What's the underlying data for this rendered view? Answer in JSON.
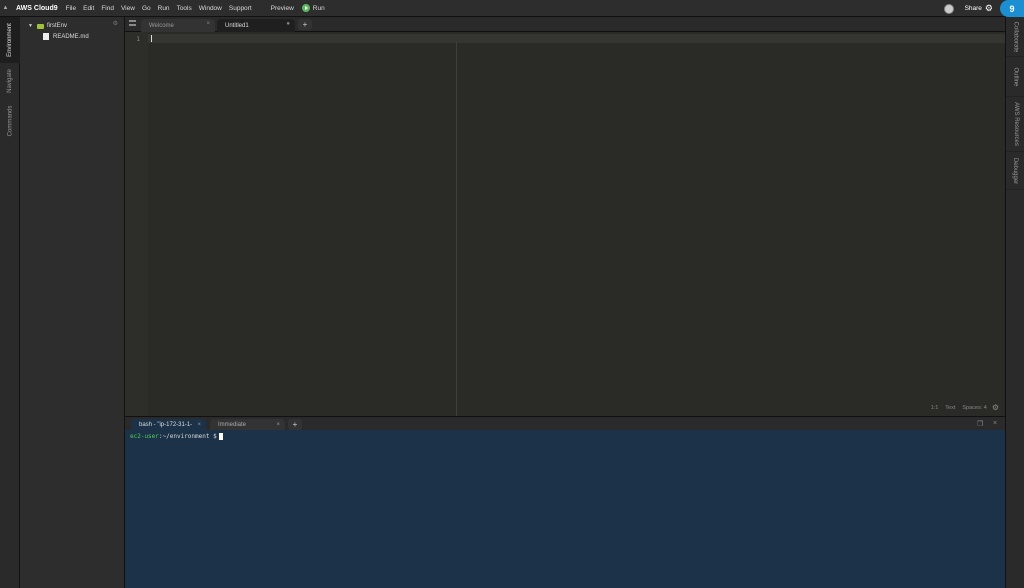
{
  "menubar": {
    "brand": "AWS Cloud9",
    "items": [
      "File",
      "Edit",
      "Find",
      "View",
      "Go",
      "Run",
      "Tools",
      "Window",
      "Support"
    ],
    "preview": "Preview",
    "run": "Run",
    "share": "Share"
  },
  "left_tabs": [
    "Environment",
    "Navigate",
    "Commands"
  ],
  "tree": {
    "root": "firstEnv",
    "files": [
      "README.md"
    ]
  },
  "editor": {
    "tabs": [
      {
        "label": "Welcome",
        "active": false
      },
      {
        "label": "Untitled1",
        "active": true
      }
    ],
    "line_number": "1",
    "status": {
      "position": "1:1",
      "mode": "Text",
      "indent": "Spaces: 4"
    }
  },
  "terminal": {
    "tabs": [
      {
        "label": "bash - \"ip-172-31-1-",
        "active": true
      },
      {
        "label": "Immediate",
        "active": false
      }
    ],
    "prompt_user": "ec2-user",
    "prompt_path": ":~/environment $"
  },
  "right_tabs": [
    "Collaborate",
    "Outline",
    "AWS Resources",
    "Debugger"
  ],
  "colors": {
    "accent": "#1b8fd1",
    "terminal_bg": "#1b3249",
    "prompt_user": "#4fd34f"
  }
}
